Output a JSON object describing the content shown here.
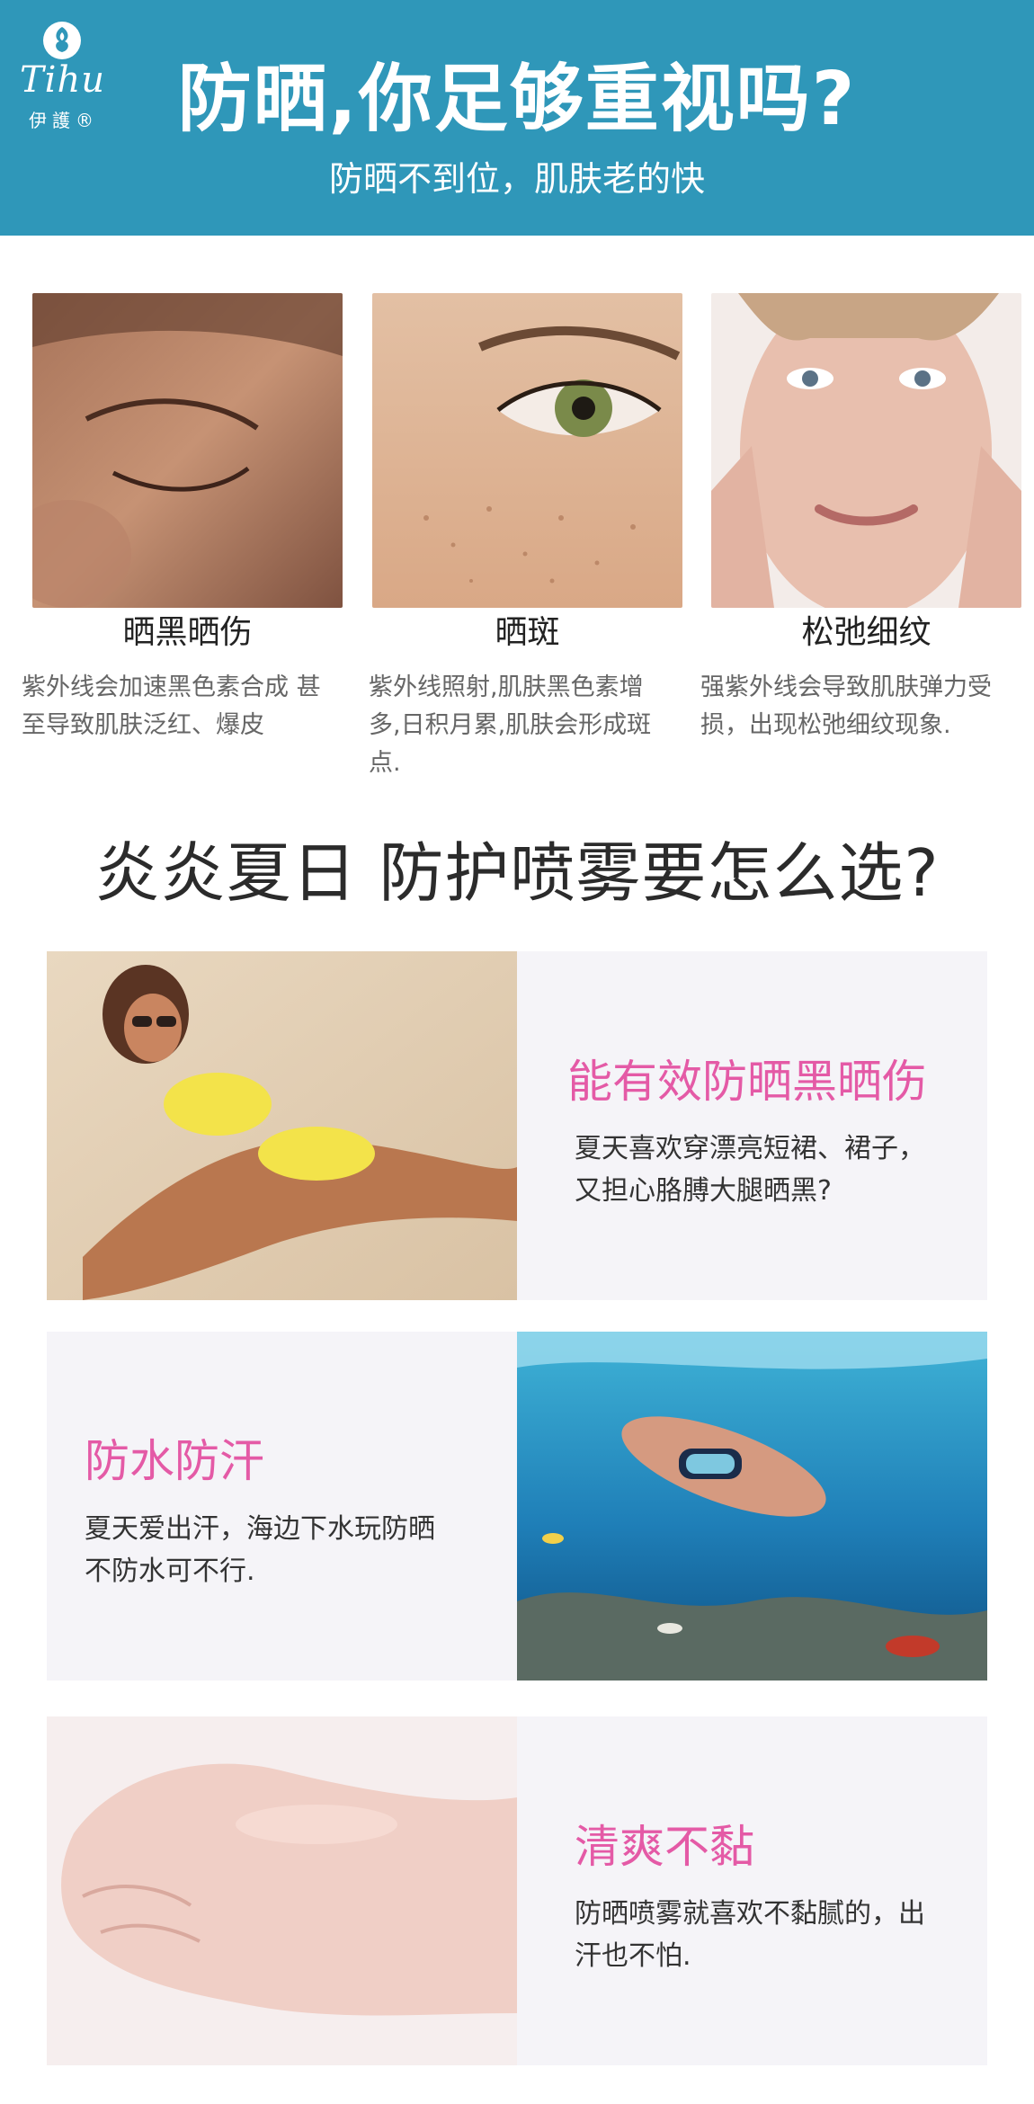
{
  "header": {
    "logo_script": "Tihu",
    "logo_cn": "伊護®",
    "title": "防晒,你足够重视吗?",
    "subtitle": "防晒不到位，肌肤老的快"
  },
  "damage_cards": [
    {
      "title": "晒黑晒伤",
      "desc_lines": [
        "紫外线会加速黑色素合成 甚",
        "至导致肌肤泛红、爆皮"
      ]
    },
    {
      "title": "晒斑",
      "desc_lines": [
        "紫外线照射,肌肤黑色素增",
        "多,日积月累,肌肤会形成斑",
        "点."
      ]
    },
    {
      "title": "松弛细纹",
      "desc_lines": [
        "强紫外线会导致肌肤弹力受",
        "损，出现松弛细纹现象."
      ]
    }
  ],
  "section": {
    "title": "炎炎夏日 防护喷雾要怎么选?"
  },
  "features": [
    {
      "heading": "能有效防晒黑晒伤",
      "body_lines": [
        "夏天喜欢穿漂亮短裙、裙子，",
        "又担心胳膊大腿晒黑?"
      ]
    },
    {
      "heading": "防水防汗",
      "body_lines": [
        "夏天爱出汗，海边下水玩防晒",
        "不防水可不行."
      ]
    },
    {
      "heading": "清爽不黏",
      "body_lines": [
        "防晒喷雾就喜欢不黏腻的，出",
        "汗也不怕."
      ]
    }
  ],
  "colors": {
    "banner": "#2f97b9",
    "accent_pink": "#e45aa6",
    "feature_bg": "#f5f4f8"
  },
  "icons": {
    "logo": "rose-logo-icon"
  }
}
